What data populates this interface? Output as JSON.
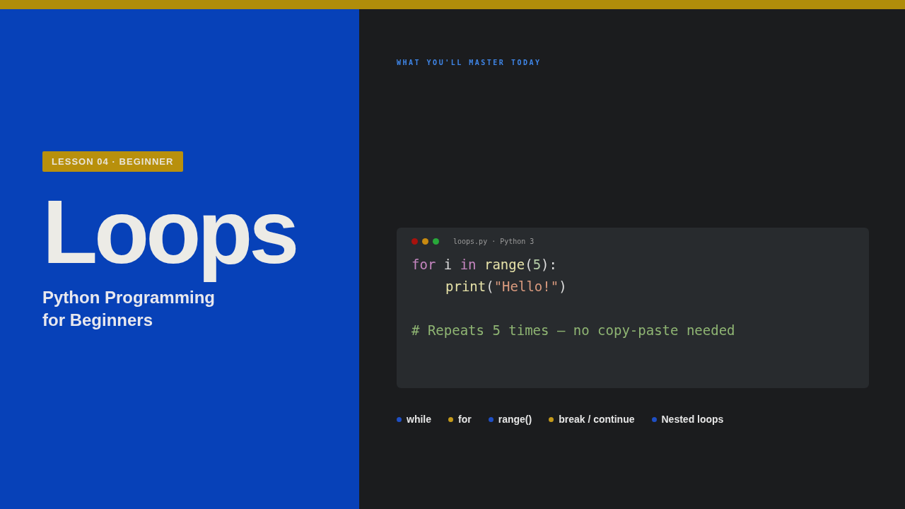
{
  "badge": "LESSON 04 · BEGINNER",
  "title": "Loops",
  "subtitle_lines": [
    "Python Programming",
    "for Beginners"
  ],
  "section_label": "WHAT YOU'LL MASTER TODAY",
  "editor": {
    "filename": "loops.py · Python 3",
    "lines": [
      {
        "kind": "code",
        "tokens": [
          {
            "kind": "keyword",
            "text": "for "
          },
          {
            "kind": "plain",
            "text": "i "
          },
          {
            "kind": "keyword",
            "text": "in "
          },
          {
            "kind": "function",
            "text": "range"
          },
          {
            "kind": "plain",
            "text": "("
          },
          {
            "kind": "number",
            "text": "5"
          },
          {
            "kind": "plain",
            "text": "):"
          }
        ],
        "children": [
          {
            "kind": "code",
            "tokens": [
              {
                "kind": "function",
                "text": "print"
              },
              {
                "kind": "plain",
                "text": "("
              },
              {
                "kind": "string",
                "text": "\"Hello!\""
              },
              {
                "kind": "plain",
                "text": ")"
              }
            ]
          }
        ]
      },
      {
        "kind": "comment",
        "tokens": [
          {
            "kind": "comment",
            "text": "# Repeats 5 times — no copy-paste needed"
          }
        ]
      }
    ]
  },
  "topics": [
    {
      "label": "while",
      "color": "#1f4fc4"
    },
    {
      "label": "for",
      "color": "#c49a1a"
    },
    {
      "label": "range()",
      "color": "#1f4fc4"
    },
    {
      "label": "break / continue",
      "color": "#c49a1a"
    },
    {
      "label": "Nested loops",
      "color": "#1f4fc4"
    }
  ]
}
